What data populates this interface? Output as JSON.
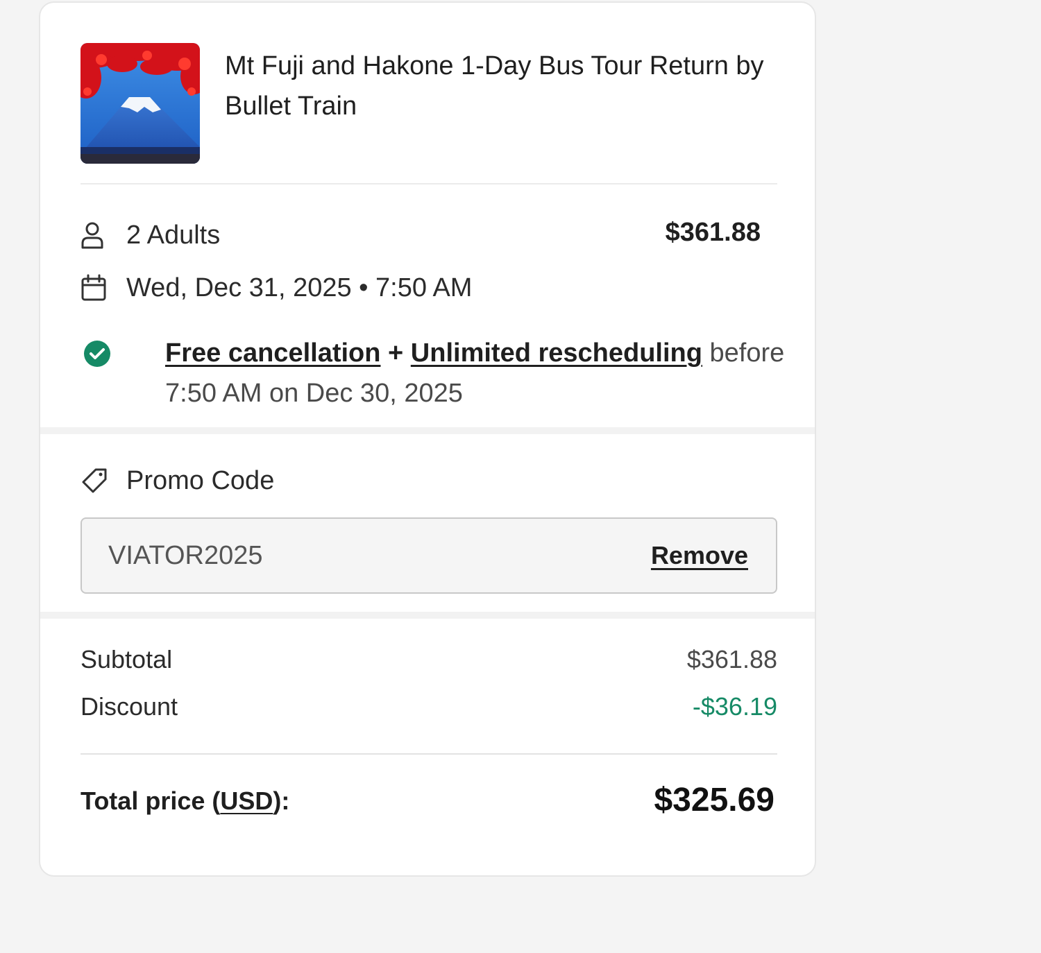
{
  "product": {
    "title": "Mt Fuji and Hakone 1-Day Bus Tour Return by Bullet Train",
    "image_icon": "mount-fuji-photo"
  },
  "booking": {
    "travelers": "2 Adults",
    "travelers_price": "$361.88",
    "date_time": "Wed, Dec 31, 2025 • 7:50 AM"
  },
  "cancellation": {
    "free_cancellation": "Free cancellation",
    "plus": "+",
    "unlimited_rescheduling": "Unlimited rescheduling",
    "deadline": "before 7:50 AM on Dec 30, 2025"
  },
  "promo": {
    "label": "Promo Code",
    "code": "VIATOR2025",
    "remove_label": "Remove"
  },
  "summary": {
    "subtotal_label": "Subtotal",
    "subtotal_value": "$361.88",
    "discount_label": "Discount",
    "discount_value": "-$36.19",
    "total_label_prefix": "Total price (",
    "total_currency": "USD",
    "total_label_suffix": "):",
    "total_value": "$325.69"
  },
  "colors": {
    "accent_green": "#168a66",
    "page_background": "#f4f4f4",
    "card_background": "#ffffff"
  }
}
